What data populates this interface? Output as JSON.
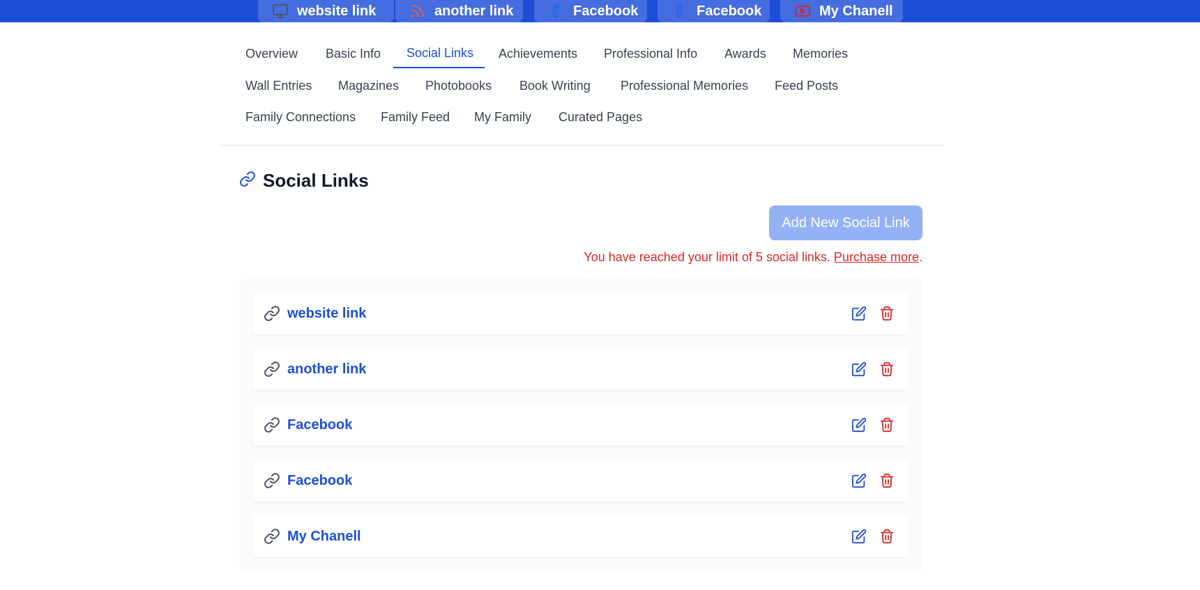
{
  "banner": {
    "links": [
      {
        "label": "website link",
        "icon": "monitor-icon"
      },
      {
        "label": "another link",
        "icon": "rss-icon"
      },
      {
        "label": "Facebook",
        "icon": "facebook-icon"
      },
      {
        "label": "Facebook",
        "icon": "facebook-icon"
      },
      {
        "label": "My Chanell",
        "icon": "youtube-icon"
      }
    ]
  },
  "tabs": {
    "row1": [
      "Overview",
      "Basic Info",
      "Social Links",
      "Achievements",
      "Professional Info",
      "Awards",
      "Memories"
    ],
    "row2": [
      "Wall Entries",
      "Magazines",
      "Photobooks",
      "Book Writing",
      "Professional Memories",
      "Feed Posts"
    ],
    "row3": [
      "Family Connections",
      "Family Feed",
      "My Family",
      "Curated Pages"
    ],
    "active": "Social Links"
  },
  "section": {
    "title": "Social Links",
    "add_button": "Add New Social Link",
    "limit_message": "You have reached your limit of 5 social links.",
    "purchase_link": "Purchase more",
    "purchase_suffix": "."
  },
  "links": [
    {
      "title": "website link"
    },
    {
      "title": "another link"
    },
    {
      "title": "Facebook"
    },
    {
      "title": "Facebook"
    },
    {
      "title": "My Chanell"
    }
  ],
  "colors": {
    "banner": "#1d4ed8",
    "accent": "#1d4ed8",
    "danger": "#dc2626",
    "button_disabled": "#93b1f5"
  }
}
